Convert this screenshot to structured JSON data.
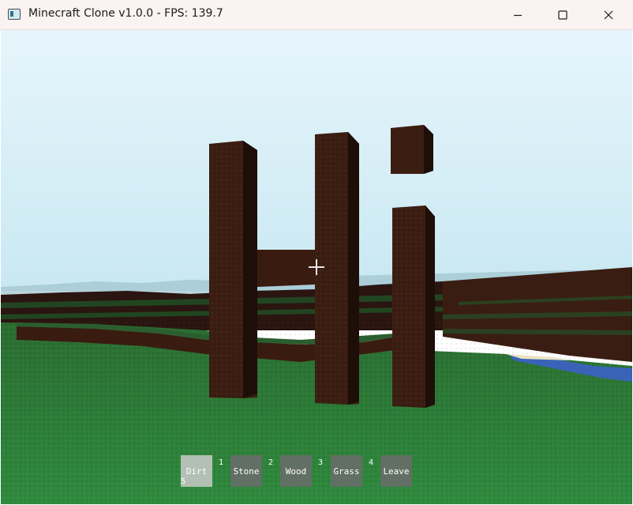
{
  "window": {
    "title": "Minecraft Clone v1.0.0 - FPS: 139.7",
    "icon": "app-window-icon",
    "controls": [
      "minimize-icon",
      "maximize-icon",
      "close-icon"
    ]
  },
  "scene": {
    "sky_color": "#dff1f8",
    "grass_color": "#2d7d3a",
    "block_color": "#3b1d12",
    "water_color": "#3a63b8",
    "structure_text": "Hi"
  },
  "hud": {
    "crosshair": "crosshair-icon",
    "hotbar": {
      "selected_index": 0,
      "slots": [
        {
          "label": "Dirt",
          "number": "1"
        },
        {
          "label": "Stone",
          "number": "2"
        },
        {
          "label": "Wood",
          "number": "3"
        },
        {
          "label": "Grass",
          "number": "4"
        },
        {
          "label": "Leave",
          "number": "5"
        }
      ]
    }
  }
}
